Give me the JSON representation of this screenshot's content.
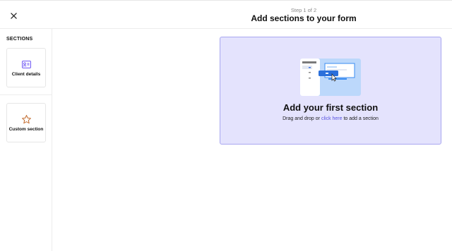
{
  "header": {
    "step_label": "Step 1 of 2",
    "title": "Add sections to your form",
    "close_icon": "close-icon"
  },
  "sidebar": {
    "heading": "SECTIONS",
    "items": [
      {
        "label": "Client details",
        "icon": "client-card-icon"
      },
      {
        "label": "Custom section",
        "icon": "star-icon"
      }
    ]
  },
  "dropzone": {
    "title": "Add your first section",
    "desc_before": "Drag and drop or",
    "desc_link": "click here",
    "desc_after": "to add a section"
  },
  "colors": {
    "accent": "#6950f3",
    "dropzone_bg": "#e4e3fd",
    "dropzone_border": "#a8a6f0",
    "link": "#5a54e0",
    "star": "#c2692a"
  }
}
